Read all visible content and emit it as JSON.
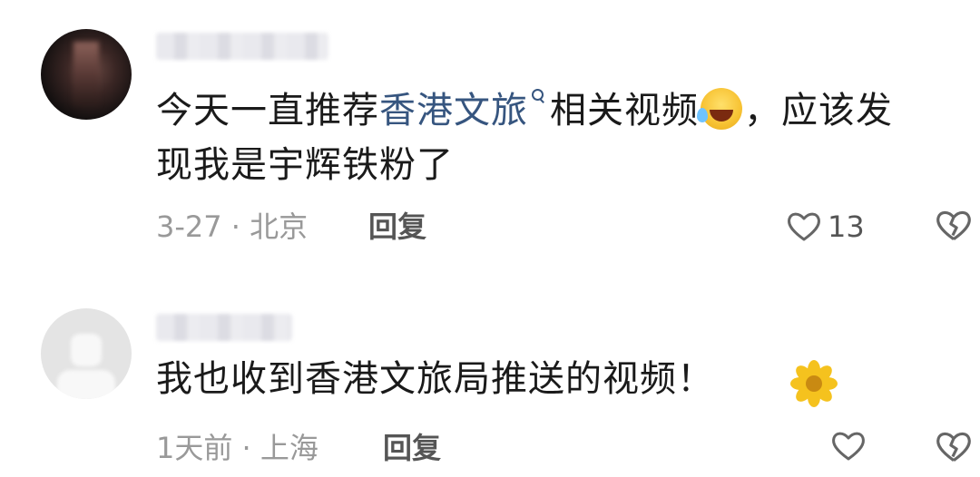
{
  "comments": [
    {
      "content_before": "今天一直推荐",
      "content_link": "香港文旅",
      "content_mid": "相关视频",
      "content_after": "，应该发",
      "content_line2": "现我是宇辉铁粉了",
      "meta": "3-27 · 北京",
      "reply_label": "回复",
      "like_count": "13",
      "icons": [
        "search-icon",
        "laughing-tears-emoji",
        "heart-icon",
        "broken-heart-icon"
      ]
    },
    {
      "content": "我也收到香港文旅局推送的视频！",
      "meta": "1天前 · 上海",
      "reply_label": "回复",
      "like_count": "",
      "icons": [
        "sunflower-emoji",
        "heart-icon",
        "broken-heart-icon"
      ]
    }
  ],
  "colors": {
    "link": "#36557f",
    "meta_text": "#999999",
    "body_text": "#1a1a1a"
  }
}
